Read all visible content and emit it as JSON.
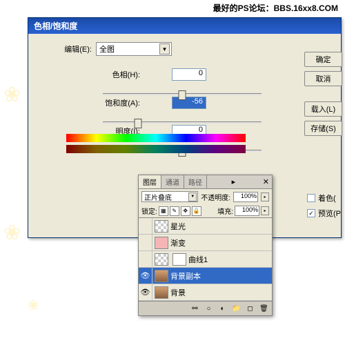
{
  "watermark_top": "最好的PS论坛：BBS.16xx8.COM",
  "dialog": {
    "title": "色相/饱和度",
    "edit_label": "编辑(E):",
    "edit_value": "全图",
    "hue_label": "色相(H):",
    "hue_value": "0",
    "sat_label": "饱和度(A):",
    "sat_value": "-56",
    "light_label": "明度(I):",
    "light_value": "0",
    "buttons": {
      "ok": "确定",
      "cancel": "取消",
      "load": "载入(L)",
      "save": "存储(S)"
    },
    "colorize_label": "着色(",
    "preview_label": "预览(P"
  },
  "layers": {
    "tabs": [
      "图层",
      "通道",
      "路径"
    ],
    "blend_mode": "正片叠底",
    "opacity_label": "不透明度:",
    "opacity_value": "100%",
    "lock_label": "锁定:",
    "fill_label": "填充:",
    "fill_value": "100%",
    "items": [
      {
        "name": "星光",
        "eye": false
      },
      {
        "name": "渐变",
        "eye": false
      },
      {
        "name": "曲线1",
        "eye": false
      },
      {
        "name": "背景副本",
        "eye": true,
        "selected": true
      },
      {
        "name": "背景",
        "eye": true
      }
    ]
  }
}
